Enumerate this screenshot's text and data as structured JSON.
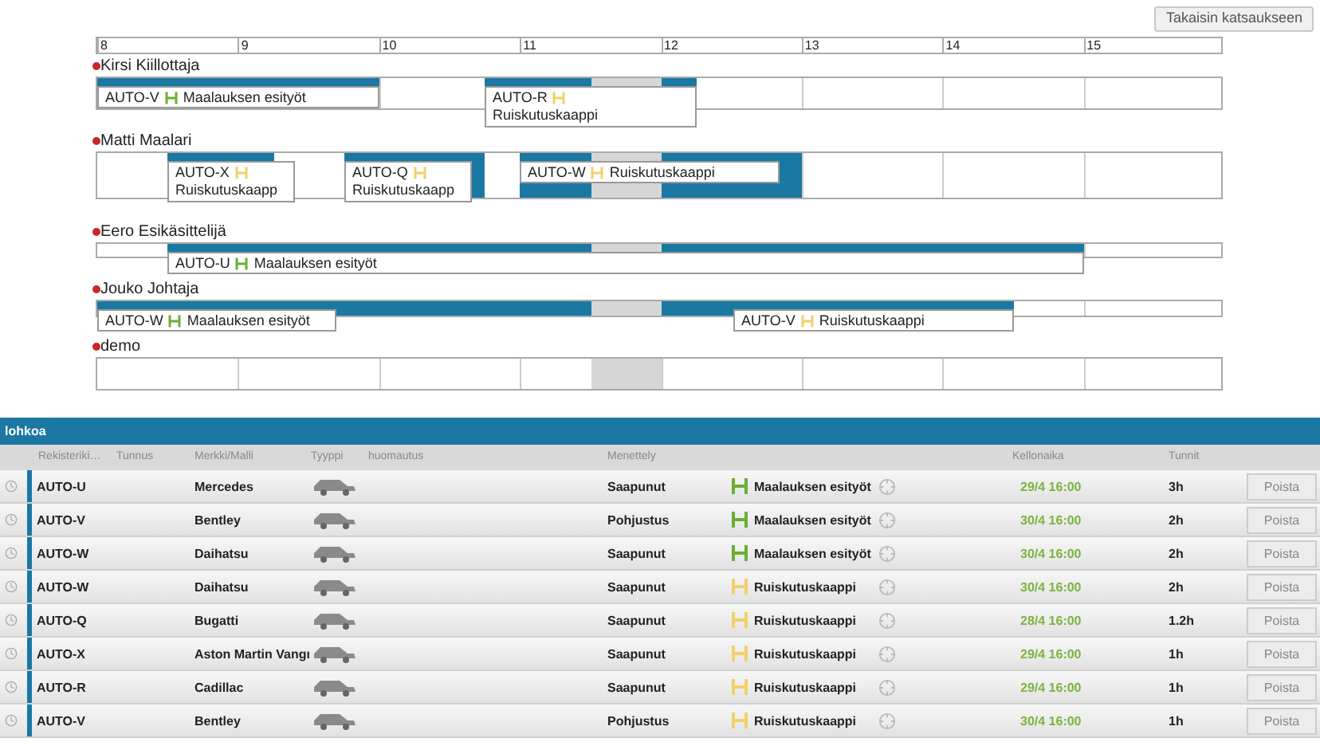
{
  "back_button": "Takaisin katsaukseen",
  "timeline": {
    "hours": [
      "8",
      "9",
      "10",
      "11",
      "12",
      "13",
      "14",
      "15"
    ],
    "lanes": [
      {
        "name": "Kirsi Kiillottaja",
        "tasks": [
          {
            "car": "AUTO-V",
            "stage": "Maalauksen esityöt",
            "color": "#6cae35"
          },
          {
            "car": "AUTO-R",
            "stage": "Ruiskutuskaappi",
            "color": "#f2d06b"
          }
        ]
      },
      {
        "name": "Matti Maalari",
        "tasks": [
          {
            "car": "AUTO-X",
            "stage": "Ruiskutuskaapp",
            "color": "#f2d06b"
          },
          {
            "car": "AUTO-Q",
            "stage": "Ruiskutuskaapp",
            "color": "#f2d06b"
          },
          {
            "car": "AUTO-W",
            "stage": "Ruiskutuskaappi",
            "color": "#f2d06b"
          }
        ]
      },
      {
        "name": "Eero Esikäsittelijä",
        "tasks": [
          {
            "car": "AUTO-U",
            "stage": "Maalauksen esityöt",
            "color": "#6cae35"
          }
        ]
      },
      {
        "name": "Jouko Johtaja",
        "tasks": [
          {
            "car": "AUTO-W",
            "stage": "Maalauksen esityöt",
            "color": "#6cae35"
          },
          {
            "car": "AUTO-V",
            "stage": "Ruiskutuskaappi",
            "color": "#f2d06b"
          }
        ]
      },
      {
        "name": "demo"
      }
    ]
  },
  "table": {
    "title": "lohkoa",
    "columns": [
      "Rekisteriki…",
      "Tunnus",
      "Merkki/Malli",
      "Tyyppi",
      "huomautus",
      "Menettely",
      "Kellonaika",
      "Tunnit"
    ],
    "rows": [
      {
        "plate": "AUTO-U",
        "model": "Mercedes",
        "status": "Saapunut",
        "stage": "Maalauksen esityöt",
        "color": "#6cae35",
        "time": "29/4 16:00",
        "hours": "3h",
        "button": "Poista"
      },
      {
        "plate": "AUTO-V",
        "model": "Bentley",
        "status": "Pohjustus",
        "stage": "Maalauksen esityöt",
        "color": "#6cae35",
        "time": "30/4 16:00",
        "hours": "2h",
        "button": "Poista"
      },
      {
        "plate": "AUTO-W",
        "model": "Daihatsu",
        "status": "Saapunut",
        "stage": "Maalauksen esityöt",
        "color": "#6cae35",
        "time": "30/4 16:00",
        "hours": "2h",
        "button": "Poista"
      },
      {
        "plate": "AUTO-W",
        "model": "Daihatsu",
        "status": "Saapunut",
        "stage": "Ruiskutuskaappi",
        "color": "#f2d06b",
        "time": "30/4 16:00",
        "hours": "2h",
        "button": "Poista"
      },
      {
        "plate": "AUTO-Q",
        "model": "Bugatti",
        "status": "Saapunut",
        "stage": "Ruiskutuskaappi",
        "color": "#f2d06b",
        "time": "28/4 16:00",
        "hours": "1.2h",
        "button": "Poista"
      },
      {
        "plate": "AUTO-X",
        "model": "Aston Martin Vangı",
        "status": "Saapunut",
        "stage": "Ruiskutuskaappi",
        "color": "#f2d06b",
        "time": "29/4 16:00",
        "hours": "1h",
        "button": "Poista"
      },
      {
        "plate": "AUTO-R",
        "model": "Cadillac",
        "status": "Saapunut",
        "stage": "Ruiskutuskaappi",
        "color": "#f2d06b",
        "time": "29/4 16:00",
        "hours": "1h",
        "button": "Poista"
      },
      {
        "plate": "AUTO-V",
        "model": "Bentley",
        "status": "Pohjustus",
        "stage": "Ruiskutuskaappi",
        "color": "#f2d06b",
        "time": "30/4 16:00",
        "hours": "1h",
        "button": "Poista"
      }
    ]
  }
}
